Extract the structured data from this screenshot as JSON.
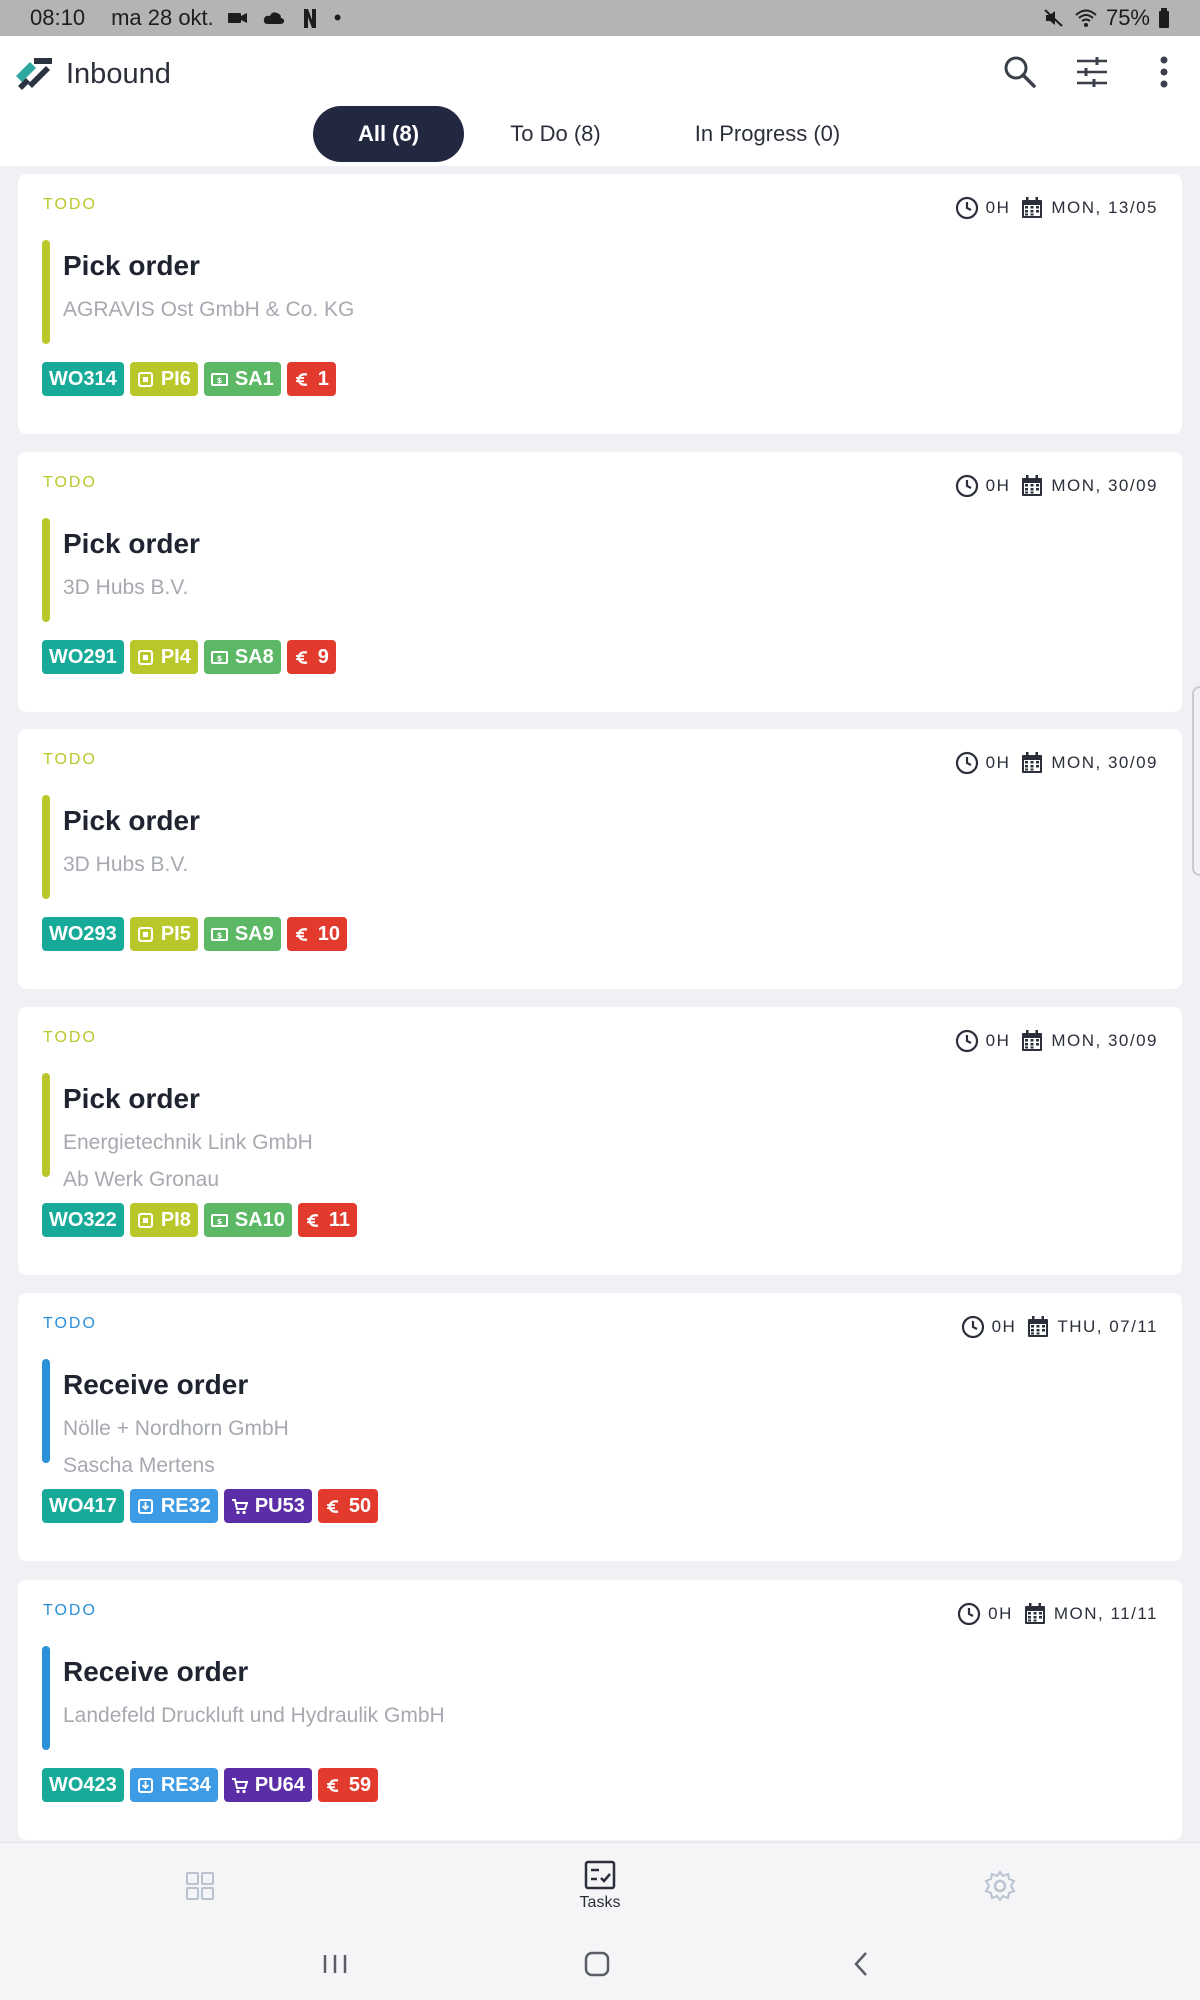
{
  "status_bar": {
    "time": "08:10",
    "date": "ma 28 okt.",
    "dot": "•",
    "battery": "75%"
  },
  "app_bar": {
    "title": "Inbound"
  },
  "tabs": [
    {
      "label": "All (8)",
      "active": true
    },
    {
      "label": "To Do (8)",
      "active": false
    },
    {
      "label": "In Progress (0)",
      "active": false
    }
  ],
  "colors": {
    "todo_pick": "#b9c72a",
    "todo_receive": "#2a90d8",
    "wo": "#17aa98",
    "pi": "#b9c72a",
    "sa": "#5db866",
    "re": "#3d9be6",
    "pu": "#5b2ea8",
    "eur": "#e23b2e"
  },
  "cards": [
    {
      "status": "TODO",
      "status_color": "#b9c72a",
      "accent": "#b9c72a",
      "hours": "0H",
      "date": "MON, 13/05",
      "title": "Pick order",
      "lines": [
        "AGRAVIS Ost GmbH & Co. KG"
      ],
      "badges": [
        {
          "label": "WO314",
          "color": "#17aa98",
          "icon": "none"
        },
        {
          "label": "PI6",
          "color": "#b9c72a",
          "icon": "pick-icon"
        },
        {
          "label": "SA1",
          "color": "#5db866",
          "icon": "sale-icon"
        },
        {
          "label": "1",
          "color": "#e23b2e",
          "icon": "euro-icon"
        }
      ]
    },
    {
      "status": "TODO",
      "status_color": "#b9c72a",
      "accent": "#b9c72a",
      "hours": "0H",
      "date": "MON, 30/09",
      "title": "Pick order",
      "lines": [
        "3D Hubs B.V."
      ],
      "badges": [
        {
          "label": "WO291",
          "color": "#17aa98",
          "icon": "none"
        },
        {
          "label": "PI4",
          "color": "#b9c72a",
          "icon": "pick-icon"
        },
        {
          "label": "SA8",
          "color": "#5db866",
          "icon": "sale-icon"
        },
        {
          "label": "9",
          "color": "#e23b2e",
          "icon": "euro-icon"
        }
      ]
    },
    {
      "status": "TODO",
      "status_color": "#b9c72a",
      "accent": "#b9c72a",
      "hours": "0H",
      "date": "MON, 30/09",
      "title": "Pick order",
      "lines": [
        "3D Hubs B.V."
      ],
      "badges": [
        {
          "label": "WO293",
          "color": "#17aa98",
          "icon": "none"
        },
        {
          "label": "PI5",
          "color": "#b9c72a",
          "icon": "pick-icon"
        },
        {
          "label": "SA9",
          "color": "#5db866",
          "icon": "sale-icon"
        },
        {
          "label": "10",
          "color": "#e23b2e",
          "icon": "euro-icon"
        }
      ]
    },
    {
      "status": "TODO",
      "status_color": "#b9c72a",
      "accent": "#b9c72a",
      "hours": "0H",
      "date": "MON, 30/09",
      "title": "Pick order",
      "lines": [
        "Energietechnik Link GmbH",
        "Ab Werk Gronau"
      ],
      "badges": [
        {
          "label": "WO322",
          "color": "#17aa98",
          "icon": "none"
        },
        {
          "label": "PI8",
          "color": "#b9c72a",
          "icon": "pick-icon"
        },
        {
          "label": "SA10",
          "color": "#5db866",
          "icon": "sale-icon"
        },
        {
          "label": "11",
          "color": "#e23b2e",
          "icon": "euro-icon"
        }
      ]
    },
    {
      "status": "TODO",
      "status_color": "#2a90d8",
      "accent": "#2a90d8",
      "hours": "0H",
      "date": "THU, 07/11",
      "title": "Receive order",
      "lines": [
        "Nölle + Nordhorn GmbH",
        "Sascha Mertens"
      ],
      "badges": [
        {
          "label": "WO417",
          "color": "#17aa98",
          "icon": "none"
        },
        {
          "label": "RE32",
          "color": "#3d9be6",
          "icon": "receive-icon"
        },
        {
          "label": "PU53",
          "color": "#5b2ea8",
          "icon": "cart-icon"
        },
        {
          "label": "50",
          "color": "#e23b2e",
          "icon": "euro-icon"
        }
      ]
    },
    {
      "status": "TODO",
      "status_color": "#2a90d8",
      "accent": "#2a90d8",
      "hours": "0H",
      "date": "MON, 11/11",
      "title": "Receive order",
      "lines": [
        "Landefeld Druckluft und Hydraulik GmbH"
      ],
      "badges": [
        {
          "label": "WO423",
          "color": "#17aa98",
          "icon": "none"
        },
        {
          "label": "RE34",
          "color": "#3d9be6",
          "icon": "receive-icon"
        },
        {
          "label": "PU64",
          "color": "#5b2ea8",
          "icon": "cart-icon"
        },
        {
          "label": "59",
          "color": "#e23b2e",
          "icon": "euro-icon"
        }
      ]
    }
  ],
  "bottom_nav": [
    {
      "label": "",
      "icon": "dashboard-icon"
    },
    {
      "label": "Tasks",
      "icon": "tasks-icon"
    },
    {
      "label": "",
      "icon": "gear-icon"
    }
  ]
}
